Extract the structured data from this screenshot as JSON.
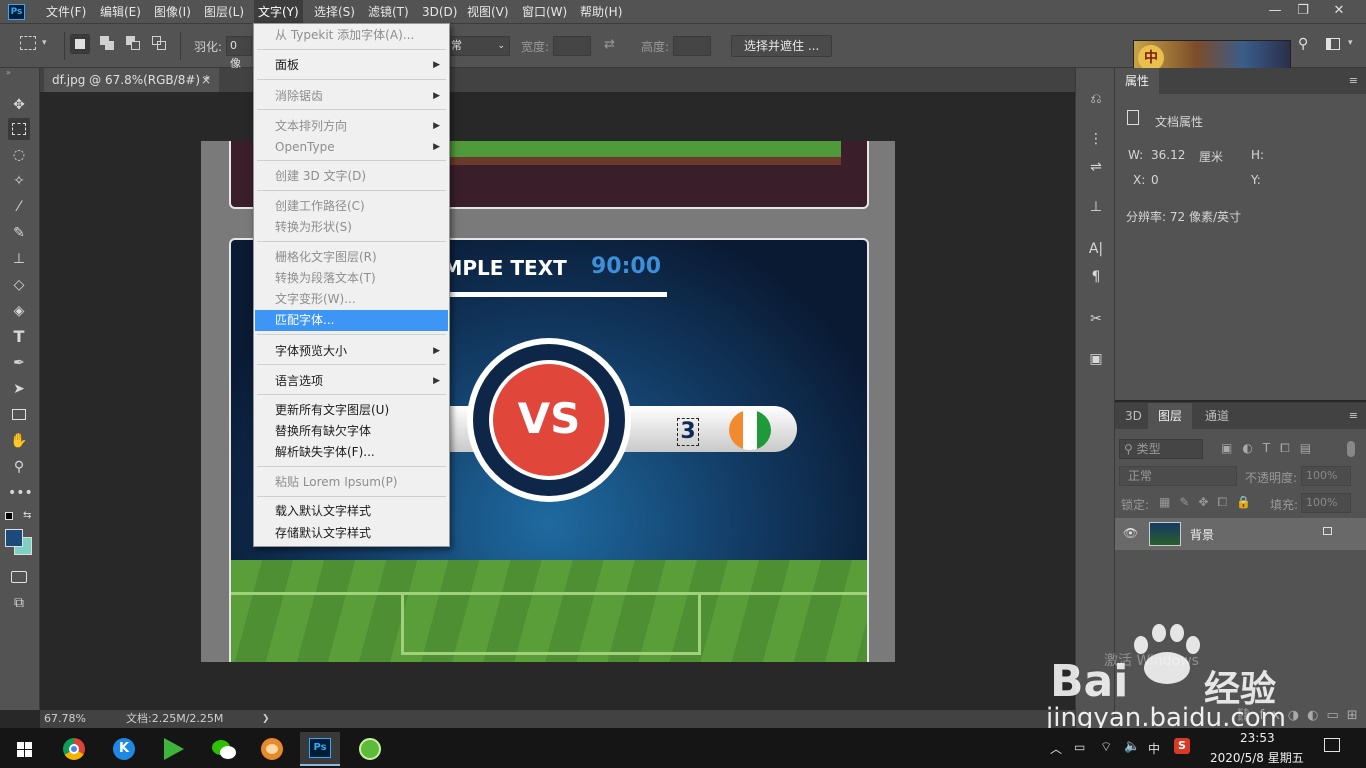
{
  "menubar": {
    "items": [
      "文件(F)",
      "编辑(E)",
      "图像(I)",
      "图层(L)",
      "文字(Y)",
      "选择(S)",
      "滤镜(T)",
      "3D(D)",
      "视图(V)",
      "窗口(W)",
      "帮助(H)"
    ],
    "active": "文字(Y)",
    "minimize": "—",
    "restore": "❐",
    "close": "✕"
  },
  "options": {
    "feather_label": "羽化:",
    "feather_value": "0 像",
    "style_value": "常",
    "width_label": "宽度:",
    "height_label": "高度:",
    "select_mask_button": "选择并遮住 ..."
  },
  "tabbar": {
    "doc_tab": "df.jpg @ 67.8%(RGB/8#) *",
    "close": "×"
  },
  "canvas_text": {
    "sample": "AMPLE TEXT",
    "time": "90:00",
    "vs": "VS",
    "score": "3"
  },
  "status": {
    "zoom": "67.78%",
    "doc_info": "文档:2.25M/2.25M",
    "arrow": "❯"
  },
  "properties": {
    "tab": "属性",
    "doc_props": "文档属性",
    "w_label": "W:",
    "w_value": "36.12",
    "w_unit": "厘米",
    "h_label": "H:",
    "x_label": "X:",
    "x_value": "0",
    "y_label": "Y:",
    "resolution": "分辨率: 72 像素/英寸"
  },
  "layers": {
    "tabs": [
      "3D",
      "图层",
      "通道"
    ],
    "active_tab": "图层",
    "filter_kind": "类型",
    "blend_mode": "正常",
    "opacity_label": "不透明度:",
    "opacity_value": "100%",
    "lock_label": "锁定:",
    "fill_label": "填充:",
    "fill_value": "100%",
    "layer_name": "背景"
  },
  "dropdown": {
    "items": [
      {
        "label": "从 Typekit 添加字体(A)...",
        "disabled": true,
        "arrow": ""
      },
      {
        "label": "面板",
        "disabled": false,
        "arrow": "▶"
      },
      {
        "label": "消除锯齿",
        "disabled": true,
        "arrow": "▶"
      },
      {
        "label": "文本排列方向",
        "disabled": true,
        "arrow": "▶"
      },
      {
        "label": "OpenType",
        "disabled": true,
        "arrow": "▶"
      },
      {
        "label": "创建 3D 文字(D)",
        "disabled": true,
        "arrow": ""
      },
      {
        "label": "创建工作路径(C)",
        "disabled": true,
        "arrow": ""
      },
      {
        "label": "转换为形状(S)",
        "disabled": true,
        "arrow": ""
      },
      {
        "label": "栅格化文字图层(R)",
        "disabled": true,
        "arrow": ""
      },
      {
        "label": "转换为段落文本(T)",
        "disabled": true,
        "arrow": ""
      },
      {
        "label": "文字变形(W)...",
        "disabled": true,
        "arrow": ""
      },
      {
        "label": "匹配字体...",
        "disabled": false,
        "arrow": "",
        "highlighted": true
      },
      {
        "label": "字体预览大小",
        "disabled": false,
        "arrow": "▶"
      },
      {
        "label": "语言选项",
        "disabled": false,
        "arrow": "▶"
      },
      {
        "label": "更新所有文字图层(U)",
        "disabled": false,
        "arrow": ""
      },
      {
        "label": "替换所有缺欠字体",
        "disabled": false,
        "arrow": ""
      },
      {
        "label": "解析缺失字体(F)...",
        "disabled": false,
        "arrow": ""
      },
      {
        "label": "粘贴 Lorem Ipsum(P)",
        "disabled": true,
        "arrow": ""
      },
      {
        "label": "载入默认文字样式",
        "disabled": false,
        "arrow": ""
      },
      {
        "label": "存储默认文字样式",
        "disabled": false,
        "arrow": ""
      }
    ]
  },
  "watermark": {
    "brand": "Bai",
    "brand_cn": "经验",
    "url": "jingyan.baidu.com",
    "activate": "激活 Windows"
  },
  "taskbar": {
    "time": "23:53",
    "date": "2020/5/8 星期五",
    "ime": "中",
    "ps_label": "Ps"
  },
  "colors": {
    "accent": "#3d95f5",
    "ps_blue": "#31a8ff",
    "panel": "#535353"
  }
}
